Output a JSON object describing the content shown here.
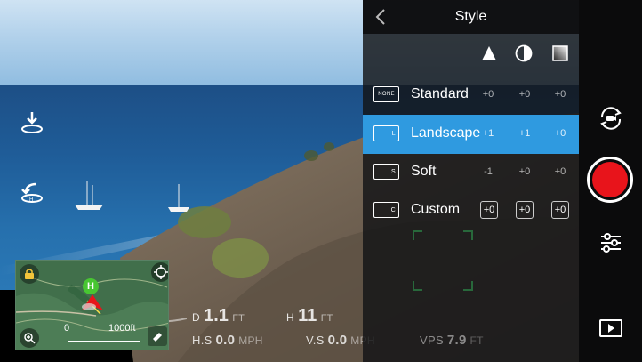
{
  "left_controls": {
    "takeoff_icon": "takeoff-icon",
    "return_home_icon": "return-home-icon"
  },
  "minimap": {
    "scale_start": "0",
    "scale_end": "1000ft",
    "home_marker": "H",
    "icons": [
      "lock-icon",
      "target-icon",
      "zoom-icon",
      "eraser-icon"
    ]
  },
  "telemetry": {
    "distance_label": "D",
    "distance_value": "1.1",
    "distance_unit": "FT",
    "height_label": "H",
    "height_value": "11",
    "height_unit": "FT",
    "hs_label": "H.S",
    "hs_value": "0.0",
    "hs_unit": "MPH",
    "vs_label": "V.S",
    "vs_value": "0.0",
    "vs_unit": "MPH",
    "vps_label": "VPS",
    "vps_value": "7.9",
    "vps_unit": "FT"
  },
  "style_panel": {
    "title": "Style",
    "column_icons": [
      "sharpness-icon",
      "contrast-icon",
      "saturation-icon"
    ],
    "rows": [
      {
        "icon_text": "NONE",
        "label": "Standard",
        "values": [
          "+0",
          "+0",
          "+0"
        ],
        "active": false
      },
      {
        "icon_text": "L",
        "label": "Landscape",
        "values": [
          "+1",
          "+1",
          "+0"
        ],
        "active": true
      },
      {
        "icon_text": "S",
        "label": "Soft",
        "values": [
          "-1",
          "+0",
          "+0"
        ],
        "active": false
      },
      {
        "icon_text": "C",
        "label": "Custom",
        "values": [
          "+0",
          "+0",
          "+0"
        ],
        "active": false
      }
    ]
  },
  "sidebar": {
    "icons": [
      "camera-switch-icon",
      "record-button",
      "settings-sliders-icon",
      "playback-icon"
    ],
    "record_color": "#e8141b"
  },
  "colors": {
    "accent": "#2f9ae0",
    "panel_bg": "#121416"
  }
}
